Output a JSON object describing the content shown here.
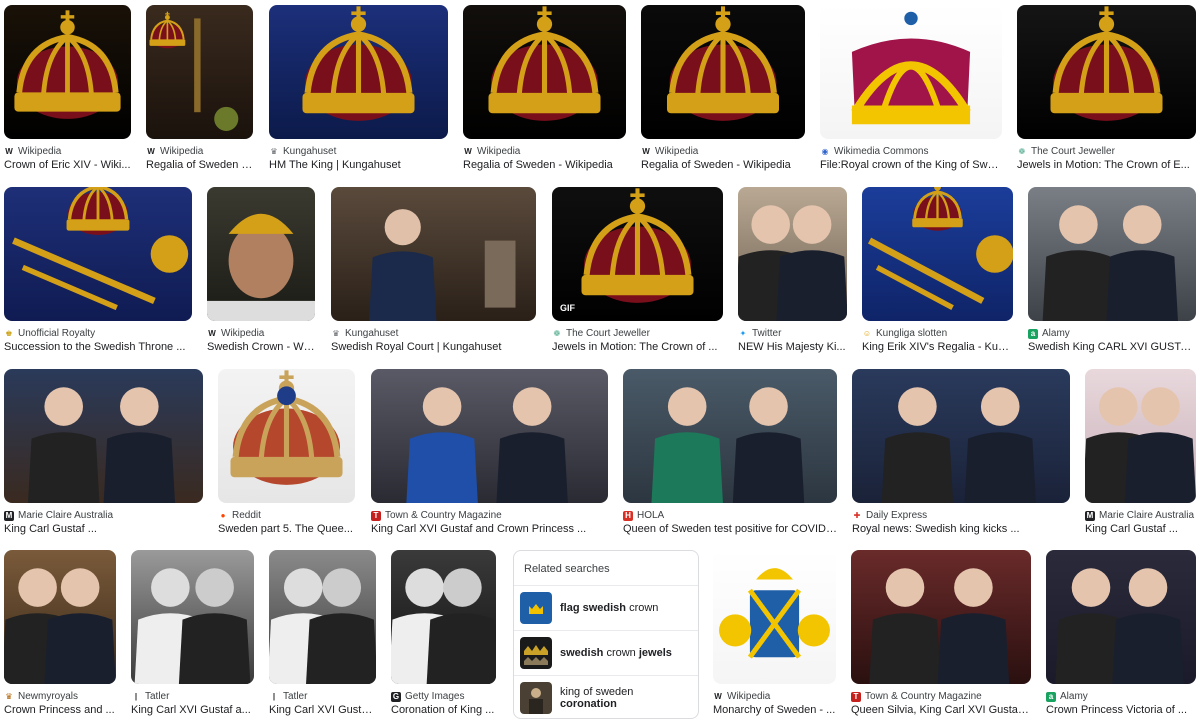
{
  "results": [
    {
      "source": "Wikipedia",
      "favicon": "W",
      "favicon_color": "#202124",
      "favicon_bg": "#ffffff",
      "title": "Crown of Eric XIV - Wiki..."
    },
    {
      "source": "Wikipedia",
      "favicon": "W",
      "favicon_color": "#202124",
      "favicon_bg": "#ffffff",
      "title": "Regalia of Sweden -..."
    },
    {
      "source": "Kungahuset",
      "favicon": "♛",
      "favicon_color": "#5f6368",
      "favicon_bg": "#ffffff",
      "title": "HM The King | Kungahuset"
    },
    {
      "source": "Wikipedia",
      "favicon": "W",
      "favicon_color": "#202124",
      "favicon_bg": "#ffffff",
      "title": "Regalia of Sweden - Wikipedia"
    },
    {
      "source": "Wikipedia",
      "favicon": "W",
      "favicon_color": "#202124",
      "favicon_bg": "#ffffff",
      "title": "Regalia of Sweden - Wikipedia"
    },
    {
      "source": "Wikimedia Commons",
      "favicon": "◉",
      "favicon_color": "#3366cc",
      "favicon_bg": "#ffffff",
      "title": "File:Royal crown of the King of Swe..."
    },
    {
      "source": "The Court Jeweller",
      "favicon": "❁",
      "favicon_color": "#4aa88a",
      "favicon_bg": "#ffffff",
      "title": "Jewels in Motion: The Crown of E..."
    },
    {
      "source": "Unofficial Royalty",
      "favicon": "♚",
      "favicon_color": "#c79a00",
      "favicon_bg": "#ffffff",
      "title": "Succession to the Swedish Throne ..."
    },
    {
      "source": "Wikipedia",
      "favicon": "W",
      "favicon_color": "#202124",
      "favicon_bg": "#ffffff",
      "title": "Swedish Crown - Wi..."
    },
    {
      "source": "Kungahuset",
      "favicon": "♛",
      "favicon_color": "#5f6368",
      "favicon_bg": "#ffffff",
      "title": "Swedish Royal Court | Kungahuset"
    },
    {
      "source": "The Court Jeweller",
      "favicon": "❁",
      "favicon_color": "#4aa88a",
      "favicon_bg": "#ffffff",
      "title": "Jewels in Motion: The Crown of ..."
    },
    {
      "source": "Twitter",
      "favicon": "✦",
      "favicon_color": "#1d9bf0",
      "favicon_bg": "#ffffff",
      "title": "NEW His Majesty Ki..."
    },
    {
      "source": "Kungliga slotten",
      "favicon": "☺",
      "favicon_color": "#e0a000",
      "favicon_bg": "#ffffff",
      "title": "King Erik XIV's Regalia - Kun..."
    },
    {
      "source": "Alamy",
      "favicon": "a",
      "favicon_color": "#ffffff",
      "favicon_bg": "#1aa260",
      "title": "Swedish King CARL XVI GUSTA..."
    },
    {
      "source": "Marie Claire Australia",
      "favicon": "M",
      "favicon_color": "#ffffff",
      "favicon_bg": "#202124",
      "title": "King Carl Gustaf ..."
    },
    {
      "source": "Reddit",
      "favicon": "●",
      "favicon_color": "#ff4500",
      "favicon_bg": "#ffffff",
      "title": "Sweden part 5. The Quee..."
    },
    {
      "source": "Town & Country Magazine",
      "favicon": "T",
      "favicon_color": "#ffffff",
      "favicon_bg": "#c5221f",
      "title": "King Carl XVI Gustaf and Crown Princess ..."
    },
    {
      "source": "HOLA",
      "favicon": "H",
      "favicon_color": "#ffffff",
      "favicon_bg": "#d93025",
      "title": "Queen of Sweden test positive for COVID-..."
    },
    {
      "source": "Daily Express",
      "favicon": "✚",
      "favicon_color": "#d93025",
      "favicon_bg": "#ffffff",
      "title": "Royal news: Swedish king kicks ..."
    },
    {
      "source": "Marie Claire Australia",
      "favicon": "M",
      "favicon_color": "#ffffff",
      "favicon_bg": "#202124",
      "title": "King Carl Gustaf ..."
    },
    {
      "source": "Newmyroyals",
      "favicon": "♛",
      "favicon_color": "#b06000",
      "favicon_bg": "#ffffff",
      "title": "Crown Princess and ..."
    },
    {
      "source": "Tatler",
      "favicon": "|",
      "favicon_color": "#202124",
      "favicon_bg": "#ffffff",
      "title": "King Carl XVI Gustaf a..."
    },
    {
      "source": "Tatler",
      "favicon": "|",
      "favicon_color": "#202124",
      "favicon_bg": "#ffffff",
      "title": "King Carl XVI Gusta..."
    },
    {
      "source": "Getty Images",
      "favicon": "G",
      "favicon_color": "#ffffff",
      "favicon_bg": "#202124",
      "title": "Coronation of King ..."
    },
    {
      "source": "Wikipedia",
      "favicon": "W",
      "favicon_color": "#202124",
      "favicon_bg": "#ffffff",
      "title": "Monarchy of Sweden - ..."
    },
    {
      "source": "Town & Country Magazine",
      "favicon": "T",
      "favicon_color": "#ffffff",
      "favicon_bg": "#c5221f",
      "title": "Queen Silvia, King Carl XVI Gustaf ..."
    },
    {
      "source": "Alamy",
      "favicon": "a",
      "favicon_color": "#ffffff",
      "favicon_bg": "#1aa260",
      "title": "Crown Princess Victoria of ..."
    }
  ],
  "gif_badge": "GIF",
  "related": {
    "title": "Related searches",
    "items": [
      {
        "bold_prefix": "flag swedish",
        "rest": " crown",
        "bold_suffix": ""
      },
      {
        "bold_prefix": "swedish",
        "rest": " crown ",
        "bold_suffix": "jewels"
      },
      {
        "bold_prefix": "",
        "rest": "king of sweden ",
        "bold_suffix": "coronation"
      }
    ]
  },
  "colors": {
    "gold": "#d4a017",
    "crown_red": "#7a0f1c",
    "royal_blue": "#1f3c88",
    "dark_bg": "#141414"
  }
}
